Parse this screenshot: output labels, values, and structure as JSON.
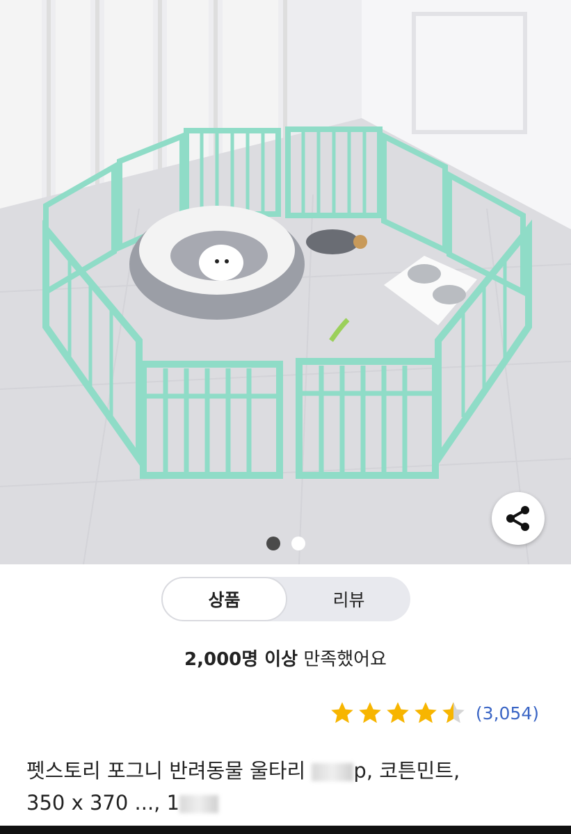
{
  "carousel": {
    "current_slide": 1,
    "total_slides": 2,
    "image_content": "teal-pet-playpen-photo",
    "share_icon": "share-icon"
  },
  "tabs": [
    {
      "label": "상품",
      "selected": true
    },
    {
      "label": "리뷰",
      "selected": false
    }
  ],
  "satisfaction": {
    "highlight": "2,000명 이상",
    "text": " 만족했어요"
  },
  "rating": {
    "stars": 4.5,
    "max_stars": 5,
    "review_count": "(3,054)",
    "star_color": "#f7b500"
  },
  "product": {
    "title_line1_a": "펫스토리 포그니 반려동물 울타리 ",
    "title_line1_b": "p, 코튼민트,",
    "title_line2_a": "350 x 370 ..., 1",
    "title_line2_b": ""
  },
  "colors": {
    "accent_link": "#3a65c5",
    "fence_mint": "#8fdcc7"
  }
}
